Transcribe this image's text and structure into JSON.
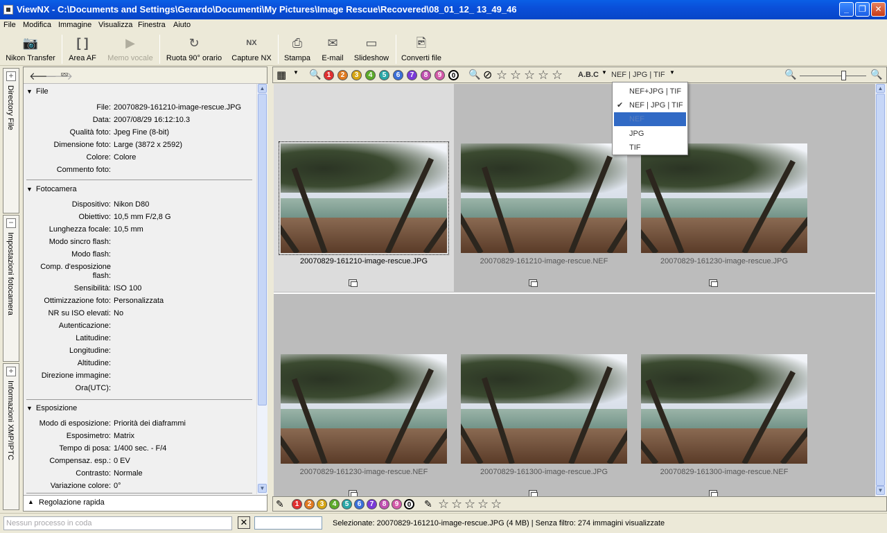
{
  "window": {
    "title": "ViewNX - C:\\Documents and Settings\\Gerardo\\Documenti\\My Pictures\\Image Rescue\\Recovered\\08_01_12_ 13_49_46"
  },
  "menu": [
    "File",
    "Modifica",
    "Immagine",
    "Visualizza",
    "Finestra",
    "Aiuto"
  ],
  "toolbar": {
    "nikon_transfer": "Nikon Transfer",
    "area_af": "Area AF",
    "memo_vocale": "Memo vocale",
    "ruota": "Ruota 90° orario",
    "capture_nx": "Capture NX",
    "stampa": "Stampa",
    "email": "E-mail",
    "slideshow": "Slideshow",
    "converti": "Converti file"
  },
  "vtabs": {
    "directory": "Directory File",
    "impostazioni": "Impostazioni fotocamera",
    "xmp": "Informazioni XMP/IPTC"
  },
  "info": {
    "file_section": "File",
    "file_rows": [
      {
        "k": "File:",
        "v": "20070829-161210-image-rescue.JPG"
      },
      {
        "k": "Data:",
        "v": "2007/08/29 16:12:10.3"
      },
      {
        "k": "Qualità foto:",
        "v": "Jpeg Fine (8-bit)"
      },
      {
        "k": "Dimensione foto:",
        "v": "Large (3872 x 2592)"
      },
      {
        "k": "Colore:",
        "v": "Colore"
      },
      {
        "k": "Commento foto:",
        "v": ""
      }
    ],
    "camera_section": "Fotocamera",
    "camera_rows": [
      {
        "k": "Dispositivo:",
        "v": "Nikon D80"
      },
      {
        "k": "Obiettivo:",
        "v": "10,5 mm F/2,8 G"
      },
      {
        "k": "Lunghezza focale:",
        "v": "10,5 mm"
      },
      {
        "k": "Modo sincro flash:",
        "v": ""
      },
      {
        "k": "Modo flash:",
        "v": ""
      },
      {
        "k": "Comp. d'esposizione",
        "v": ""
      },
      {
        "k": "flash:",
        "v": ""
      },
      {
        "k": "Sensibilità:",
        "v": "ISO 100"
      },
      {
        "k": "Ottimizzazione foto:",
        "v": "Personalizzata"
      },
      {
        "k": "NR su ISO elevati:",
        "v": "No"
      },
      {
        "k": "Autenticazione:",
        "v": ""
      },
      {
        "k": "Latitudine:",
        "v": ""
      },
      {
        "k": "Longitudine:",
        "v": ""
      },
      {
        "k": "Altitudine:",
        "v": ""
      },
      {
        "k": "Direzione immagine:",
        "v": ""
      },
      {
        "k": "Ora(UTC):",
        "v": ""
      }
    ],
    "exposure_section": "Esposizione",
    "exposure_rows": [
      {
        "k": "Modo di esposizione:",
        "v": "Priorità dei diaframmi"
      },
      {
        "k": "Esposimetro:",
        "v": "Matrix"
      },
      {
        "k": "Tempo di posa:",
        "v": "1/400 sec. - F/4"
      },
      {
        "k": "Compensaz. esp.:",
        "v": "0 EV"
      },
      {
        "k": "Contrasto:",
        "v": "Normale"
      },
      {
        "k": "Variazione colore:",
        "v": "0°"
      }
    ],
    "quick_section": "Regolazione rapida"
  },
  "filters": {
    "labels": [
      "1",
      "2",
      "3",
      "4",
      "5",
      "6",
      "7",
      "8",
      "9",
      "0"
    ],
    "label_colors": [
      "#e03030",
      "#e07a20",
      "#d6a514",
      "#5caa2a",
      "#2aa7a7",
      "#3a6fd8",
      "#7a3ad8",
      "#c04fb0",
      "#d35aa8",
      "#ffffff"
    ],
    "abc": "A.B.C",
    "format": "NEF | JPG | TIF"
  },
  "dropdown": {
    "items": [
      {
        "label": "NEF+JPG | TIF",
        "checked": false
      },
      {
        "label": "NEF | JPG | TIF",
        "checked": true
      },
      {
        "label": "NEF",
        "checked": false
      },
      {
        "label": "JPG",
        "checked": false
      },
      {
        "label": "TIF",
        "checked": false
      }
    ],
    "check_mark": "✔"
  },
  "thumbnails": [
    {
      "name": "20070829-161210-image-rescue.JPG",
      "selected": true
    },
    {
      "name": "20070829-161210-image-rescue.NEF",
      "selected": false
    },
    {
      "name": "20070829-161230-image-rescue.JPG",
      "selected": false
    },
    {
      "name": "20070829-161230-image-rescue.NEF",
      "selected": false
    },
    {
      "name": "20070829-161300-image-rescue.JPG",
      "selected": false
    },
    {
      "name": "20070829-161300-image-rescue.NEF",
      "selected": false
    }
  ],
  "status": {
    "queue_placeholder": "Nessun processo in coda",
    "close": "✕",
    "text": "Selezionate: 20070829-161210-image-rescue.JPG (4 MB) | Senza filtro: 274 immagini visualizzate"
  }
}
